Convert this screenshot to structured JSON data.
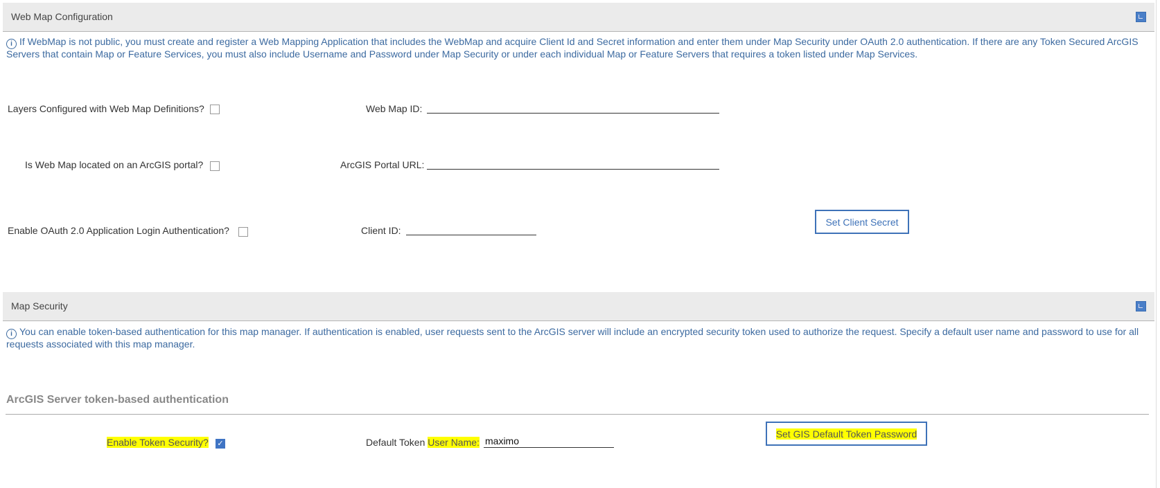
{
  "web_map_config": {
    "title": "Web Map Configuration",
    "info": "If WebMap is not public, you must create and register a Web Mapping Application that includes the WebMap and acquire Client Id and Secret information and enter them under Map Security under OAuth 2.0 authentication. If there are any Token Secured ArcGIS Servers that contain Map or Feature Services, you must also include Username and Password under Map Security or under each individual Map or Feature Servers that requires a token listed under Map Services.",
    "layers_label": "Layers Configured with Web Map Definitions?",
    "web_map_id_label": "Web Map ID:",
    "web_map_id_value": "",
    "portal_label": "Is Web Map located on an ArcGIS portal?",
    "portal_url_label": "ArcGIS Portal URL:",
    "portal_url_value": "",
    "oauth_label": "Enable OAuth 2.0 Application Login Authentication?",
    "client_id_label": "Client ID:",
    "client_id_value": "",
    "set_client_secret": "Set Client Secret"
  },
  "map_security": {
    "title": "Map Security",
    "info": "You can enable token-based authentication for this map manager. If authentication is enabled, user requests sent to the ArcGIS server will include an encrypted security token used to authorize the request. Specify a default user name and password to use for all requests associated with this map manager.",
    "subheading": "ArcGIS Server token-based authentication",
    "enable_token_label": "Enable Token Security?",
    "enable_token_checked": true,
    "user_name_prefix": "Default Token ",
    "user_name_label": "User Name",
    "user_name_colon": ":",
    "user_name_value": "maximo",
    "set_password": "Set GIS Default Token Password"
  },
  "info_icon": "i"
}
